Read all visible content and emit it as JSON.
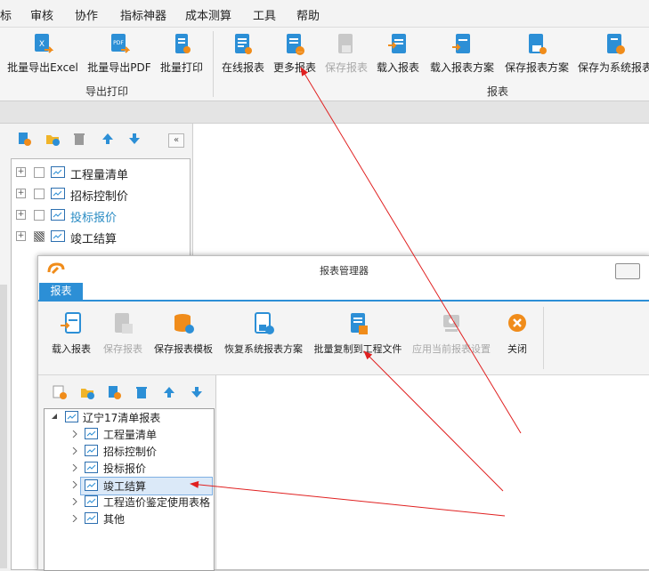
{
  "menu": [
    "标",
    "审核",
    "协作",
    "指标神器",
    "成本测算",
    "工具",
    "帮助"
  ],
  "ribbon": {
    "buttons": [
      {
        "label": "批量导出Excel",
        "icon": "excel-export-icon",
        "disabled": false
      },
      {
        "label": "批量导出PDF",
        "icon": "pdf-export-icon",
        "disabled": false
      },
      {
        "label": "批量打印",
        "icon": "print-icon",
        "disabled": false
      },
      {
        "label": "在线报表",
        "icon": "online-report-icon",
        "disabled": false
      },
      {
        "label": "更多报表",
        "icon": "more-reports-icon",
        "disabled": false
      },
      {
        "label": "保存报表",
        "icon": "save-report-icon",
        "disabled": true
      },
      {
        "label": "载入报表",
        "icon": "load-report-icon",
        "disabled": false
      },
      {
        "label": "载入报表方案",
        "icon": "load-scheme-icon",
        "disabled": false
      },
      {
        "label": "保存报表方案",
        "icon": "save-scheme-icon",
        "disabled": false
      },
      {
        "label": "保存为系统报表",
        "icon": "save-system-report-icon",
        "disabled": false
      }
    ],
    "groups": {
      "export_print": "导出打印",
      "reports": "报表"
    }
  },
  "tree": {
    "items": [
      {
        "label": "工程量清单",
        "checked": "none",
        "link": false
      },
      {
        "label": "招标控制价",
        "checked": "none",
        "link": false
      },
      {
        "label": "投标报价",
        "checked": "none",
        "link": true
      },
      {
        "label": "竣工结算",
        "checked": "partial",
        "link": false
      }
    ]
  },
  "dialog": {
    "title": "报表管理器",
    "tab": "报表",
    "buttons": [
      {
        "label": "载入报表",
        "icon": "load-report-icon",
        "disabled": false
      },
      {
        "label": "保存报表",
        "icon": "save-report-icon",
        "disabled": true
      },
      {
        "label": "保存报表模板",
        "icon": "save-template-icon",
        "disabled": false
      },
      {
        "label": "恢复系统报表方案",
        "icon": "restore-scheme-icon",
        "disabled": false
      },
      {
        "label": "批量复制到工程文件",
        "icon": "batch-copy-icon",
        "disabled": false
      },
      {
        "label": "应用当前报表设置",
        "icon": "apply-settings-icon",
        "disabled": true
      },
      {
        "label": "关闭",
        "icon": "close-icon",
        "disabled": false
      }
    ],
    "tree": {
      "root": "辽宁17清单报表",
      "children": [
        "工程量清单",
        "招标控制价",
        "投标报价",
        "竣工结算",
        "工程造价鉴定使用表格",
        "其他"
      ],
      "selected": "竣工结算"
    }
  },
  "colors": {
    "accent": "#2c8fd6",
    "annotation_arrow": "#e02020",
    "link": "#2a8cc4"
  }
}
